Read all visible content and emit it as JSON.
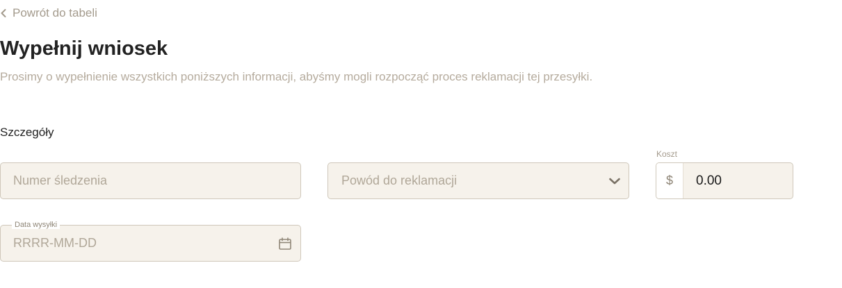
{
  "back_link": {
    "label": "Powrót do tabeli",
    "icon": "chevron-left-icon"
  },
  "title": "Wypełnij wniosek",
  "subtitle": "Prosimy o wypełnienie wszystkich poniższych informacji, abyśmy mogli rozpocząć proces reklamacji tej przesyłki.",
  "section": {
    "title": "Szczegóły"
  },
  "form": {
    "tracking": {
      "placeholder": "Numer śledzenia",
      "value": ""
    },
    "reason": {
      "placeholder": "Powód do reklamacji",
      "icon": "chevron-down-icon"
    },
    "cost": {
      "label": "Koszt",
      "currency": "$",
      "value": "0.00"
    },
    "ship_date": {
      "label": "Data wysyłki",
      "placeholder": "RRRR-MM-DD",
      "value": "",
      "icon": "calendar-icon"
    }
  },
  "colors": {
    "field_background": "#f6f2eb",
    "field_border": "#cfc7ba",
    "muted_text": "#b5ab9d",
    "heading": "#222222"
  }
}
